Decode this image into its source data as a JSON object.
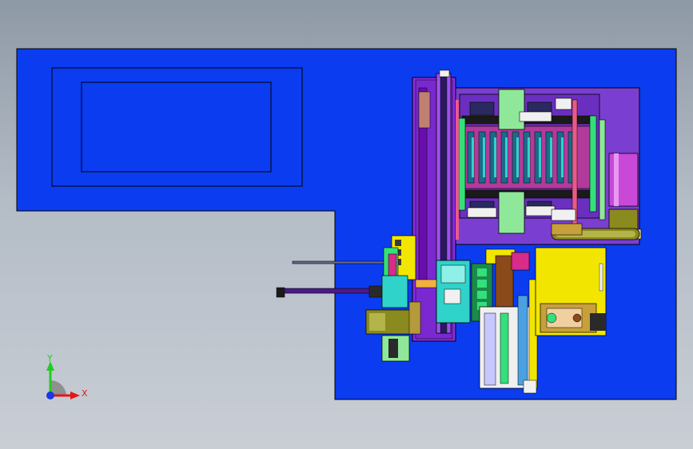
{
  "viewport": {
    "background_top": "#8e99a6",
    "background_bottom": "#c9ced5"
  },
  "model": {
    "base_plate_color": "#0b3cf0",
    "outline_color": "#000000",
    "frame_purple": "#8a2be2",
    "dark_purple": "#6a0dad",
    "tray_purple": "#7a3fd0",
    "green": "#33e07a",
    "lime": "#8fe89a",
    "cyan": "#2fd3c9",
    "yellow": "#f2e600",
    "olive": "#8a8a1e",
    "orange": "#c87a20",
    "magenta": "#c848d8",
    "pink": "#e85a8a",
    "brown": "#a06a2a"
  },
  "triad": {
    "y_label": "Y",
    "x_label": "X",
    "y_color": "#22cc22",
    "x_color": "#e01818",
    "z_color": "#1838e0"
  }
}
